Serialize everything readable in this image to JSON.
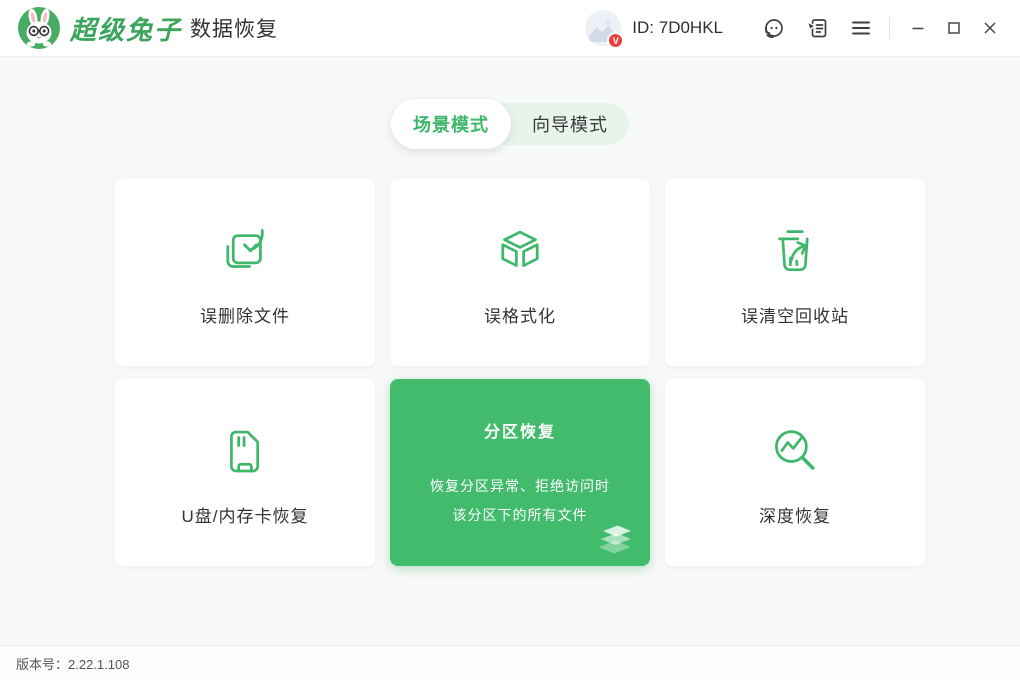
{
  "header": {
    "app_name": "超级兔子",
    "app_subtitle": "数据恢复",
    "user_id": "ID: 7D0HKL",
    "vip_badge": "V"
  },
  "tabs": {
    "scene": "场景模式",
    "wizard": "向导模式"
  },
  "cards": [
    {
      "label": "误删除文件",
      "icon": "file-restore-icon"
    },
    {
      "label": "误格式化",
      "icon": "cube-icon"
    },
    {
      "label": "误清空回收站",
      "icon": "trash-restore-icon"
    },
    {
      "label": "U盘/内存卡恢复",
      "icon": "sd-card-icon"
    },
    {
      "label": "分区恢复",
      "icon": "layers-icon",
      "description_line1": "恢复分区异常、拒绝访问时",
      "description_line2": "该分区下的所有文件",
      "highlighted": true
    },
    {
      "label": "深度恢复",
      "icon": "deep-scan-icon"
    }
  ],
  "footer": {
    "version": "版本号：2.22.1.108"
  },
  "colors": {
    "accent_green": "#3eb76a",
    "card_green": "#42bb6d",
    "logo_green": "#47ad63",
    "badge_red": "#e9403d",
    "tab_track_green": "#e7f4ec",
    "background_gray": "#f7f8f8"
  }
}
